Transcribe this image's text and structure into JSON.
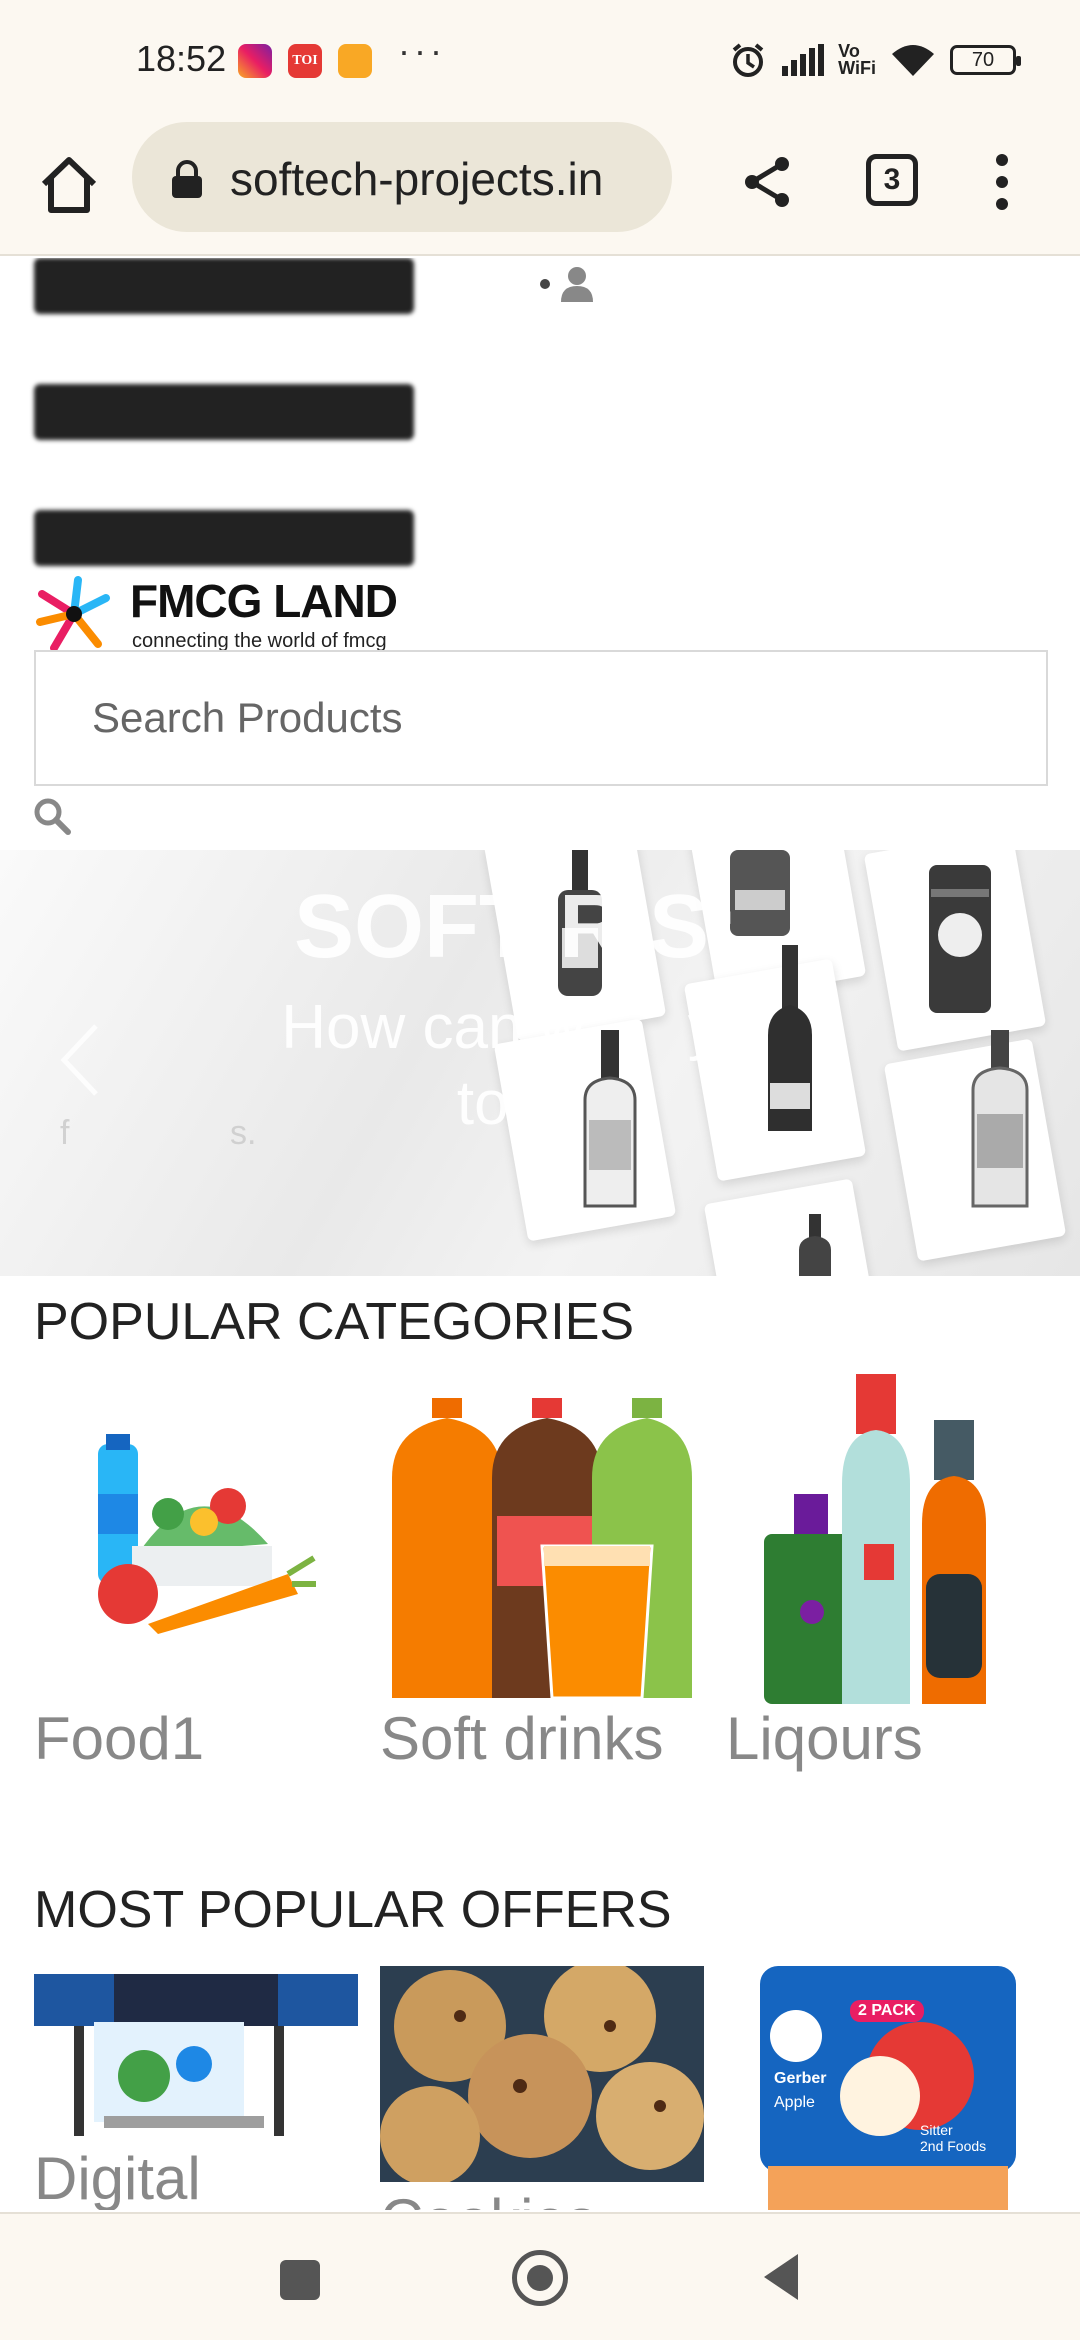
{
  "status_bar": {
    "time": "18:52",
    "apps": [
      "instagram-icon",
      "toi-icon",
      "notes-icon"
    ],
    "toi_label": "TOI",
    "more": "···",
    "vowifi": "Vo\nWiFi",
    "battery": "70"
  },
  "browser": {
    "url": "softech-projects.in",
    "tab_count": "3"
  },
  "site": {
    "logo_title": "FMCG LAND",
    "logo_subtitle": "connecting the world of fmcg",
    "search_placeholder": "Search Products"
  },
  "banner": {
    "headline": "SOFT   R   S:",
    "subline": "How can w      y\ntod",
    "faint_text": "f                 s."
  },
  "categories": {
    "title": "POPULAR CATEGORIES",
    "items": [
      {
        "label": "Food1"
      },
      {
        "label": "Soft drinks"
      },
      {
        "label": "Liqours"
      }
    ]
  },
  "offers": {
    "title": "MOST POPULAR OFFERS",
    "items": [
      {
        "label": "Digital"
      },
      {
        "label": "Cookies"
      },
      {
        "label": ""
      }
    ],
    "gerber_brand": "Gerber",
    "gerber_flavor": "Apple",
    "gerber_pack": "2 PACK",
    "gerber_stage": "Sitter\n2nd Foods"
  },
  "colors": {
    "chrome_bg": "#fcf8f1",
    "urlbar_bg": "#ebe6d8",
    "category_label": "#888888"
  }
}
